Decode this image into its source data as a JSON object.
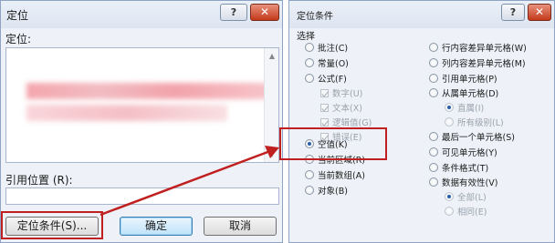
{
  "left_dialog": {
    "title": "定位",
    "help_icon": "?",
    "close_icon": "✕",
    "goto_label": "定位:",
    "reference_label": "引用位置 (R):",
    "reference_value": "",
    "buttons": {
      "special": "定位条件(S)...",
      "ok": "确定",
      "cancel": "取消"
    }
  },
  "right_dialog": {
    "title": "定位条件",
    "help_icon": "?",
    "close_icon": "✕",
    "group_label": "选择",
    "left_column": [
      {
        "label": "批注(C)",
        "kind": "radio",
        "checked": false
      },
      {
        "label": "常量(O)",
        "kind": "radio",
        "checked": false
      },
      {
        "label": "公式(F)",
        "kind": "radio",
        "checked": false
      },
      {
        "label": "数字(U)",
        "kind": "checkbox",
        "checked": true,
        "disabled": true
      },
      {
        "label": "文本(X)",
        "kind": "checkbox",
        "checked": true,
        "disabled": true
      },
      {
        "label": "逻辑值(G)",
        "kind": "checkbox",
        "checked": true,
        "disabled": true
      },
      {
        "label": "错误(E)",
        "kind": "checkbox",
        "checked": true,
        "disabled": true
      },
      {
        "label": "空值(K)",
        "kind": "radio",
        "checked": true
      },
      {
        "label": "当前区域(R)",
        "kind": "radio",
        "checked": false
      },
      {
        "label": "当前数组(A)",
        "kind": "radio",
        "checked": false
      },
      {
        "label": "对象(B)",
        "kind": "radio",
        "checked": false
      }
    ],
    "right_column": [
      {
        "label": "行内容差异单元格(W)",
        "kind": "radio",
        "checked": false
      },
      {
        "label": "列内容差异单元格(M)",
        "kind": "radio",
        "checked": false
      },
      {
        "label": "引用单元格(P)",
        "kind": "radio",
        "checked": false
      },
      {
        "label": "从属单元格(D)",
        "kind": "radio",
        "checked": false
      },
      {
        "label": "直属(I)",
        "kind": "radio",
        "checked": true,
        "disabled": true
      },
      {
        "label": "所有级别(L)",
        "kind": "radio",
        "checked": false,
        "disabled": true
      },
      {
        "label": "最后一个单元格(S)",
        "kind": "radio",
        "checked": false
      },
      {
        "label": "可见单元格(Y)",
        "kind": "radio",
        "checked": false
      },
      {
        "label": "条件格式(T)",
        "kind": "radio",
        "checked": false
      },
      {
        "label": "数据有效性(V)",
        "kind": "radio",
        "checked": false
      },
      {
        "label": "全部(L)",
        "kind": "radio",
        "checked": true,
        "disabled": true
      },
      {
        "label": "相同(E)",
        "kind": "radio",
        "checked": false,
        "disabled": true
      }
    ]
  },
  "colors": {
    "annotation": "#c0201f",
    "dialog_background": "#eef2f8",
    "close_button": "#c33a1a"
  }
}
